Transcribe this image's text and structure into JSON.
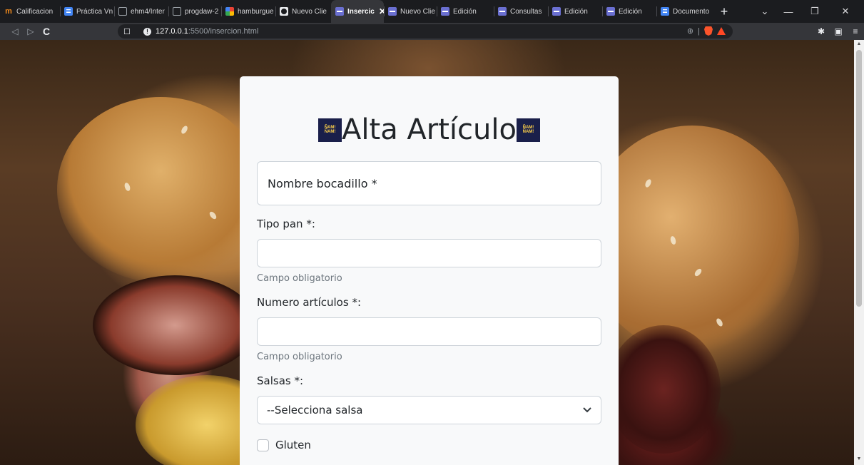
{
  "browser": {
    "tabs": [
      {
        "label": "Calificacion",
        "icon": "moodle-icon",
        "active": false
      },
      {
        "label": "Práctica Vn",
        "icon": "docs-icon",
        "active": false
      },
      {
        "label": "ehm4/Inter",
        "icon": "github-icon",
        "active": false
      },
      {
        "label": "progdaw-2",
        "icon": "github-icon",
        "active": false
      },
      {
        "label": "hamburgue",
        "icon": "google-icon",
        "active": false
      },
      {
        "label": "Nuevo Clie",
        "icon": "globe-icon",
        "active": false
      },
      {
        "label": "Insercic",
        "icon": "page-icon",
        "active": true
      },
      {
        "label": "Nuevo Clie",
        "icon": "page-icon",
        "active": false
      },
      {
        "label": "Edición",
        "icon": "page-icon",
        "active": false
      },
      {
        "label": "Consultas",
        "icon": "page-icon",
        "active": false
      },
      {
        "label": "Edición",
        "icon": "page-icon",
        "active": false
      },
      {
        "label": "Edición",
        "icon": "page-icon",
        "active": false
      },
      {
        "label": "Documento",
        "icon": "docs-icon",
        "active": false
      }
    ],
    "close_tab_glyph": "✕",
    "new_tab_glyph": "+",
    "url_host": "127.0.0.1",
    "url_path": ":5500/insercion.html",
    "window_controls": {
      "dropdown": "⌄",
      "minimize": "—",
      "restore": "❐",
      "close": "✕"
    },
    "nav": {
      "back": "◁",
      "forward": "▷",
      "reload": "C"
    }
  },
  "form": {
    "title": "Alta Artículo",
    "logo_text": [
      "ÑAM!",
      "ÑAM!"
    ],
    "nombre_placeholder": "Nombre bocadillo *",
    "tipo_pan_label": "Tipo pan *:",
    "tipo_pan_value": "",
    "tipo_pan_help": "Campo obligatorio",
    "numero_label": "Numero artículos *:",
    "numero_value": "",
    "numero_help": "Campo obligatorio",
    "salsas_label": "Salsas *:",
    "salsas_selected": "--Selecciona salsa",
    "gluten_label": "Gluten",
    "gluten_checked": false
  },
  "colors": {
    "card_bg": "#f8f9fa",
    "border": "#ced4da",
    "help_text": "#6c757d",
    "logo_bg": "#1a1f4a"
  }
}
